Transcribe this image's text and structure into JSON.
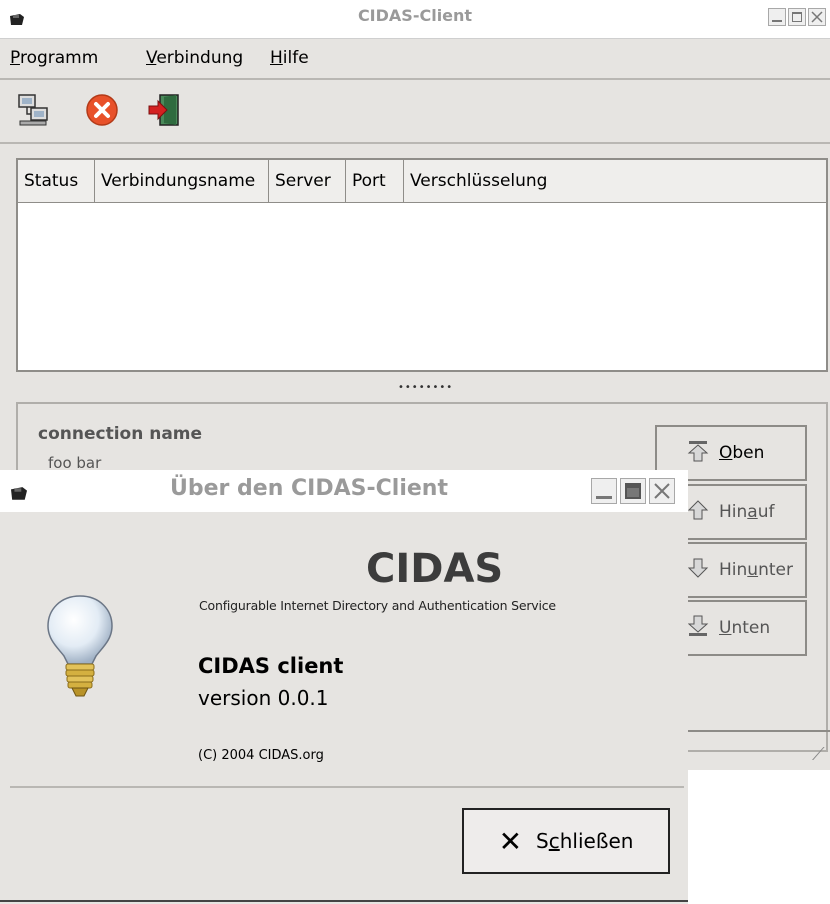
{
  "main_window": {
    "title": "CIDAS-Client",
    "menu": [
      {
        "label": "Programm",
        "mnemonic": "P",
        "rest": "rogramm"
      },
      {
        "label": "Verbindung",
        "mnemonic": "V",
        "rest": "erbindung"
      },
      {
        "label": "Hilfe",
        "mnemonic": "H",
        "rest": "ilfe"
      }
    ],
    "toolbar": [
      {
        "icon": "network-connect-icon"
      },
      {
        "icon": "disconnect-icon"
      },
      {
        "icon": "exit-door-icon"
      }
    ],
    "table": {
      "columns": [
        "Status",
        "Verbindungsname",
        "Server",
        "Port",
        "Verschlüsselung"
      ],
      "rows": []
    },
    "splitter_grip": "••••••••",
    "details": {
      "heading": "connection name",
      "value": "foo bar"
    },
    "side_buttons": [
      {
        "label": "Oben",
        "mnemonic": "O",
        "rest": "ben",
        "icon": "top-arrow-icon"
      },
      {
        "label": "Hinauf",
        "pre": "Hin",
        "mnemonic": "a",
        "rest": "uf",
        "icon": "up-arrow-icon"
      },
      {
        "label": "Hinunter",
        "pre": "Hin",
        "mnemonic": "u",
        "rest": "nter",
        "icon": "down-arrow-icon"
      },
      {
        "label": "Unten",
        "mnemonic": "U",
        "rest": "nten",
        "icon": "bottom-arrow-icon"
      }
    ]
  },
  "about_dialog": {
    "title": "Über den CIDAS-Client",
    "product": "CIDAS",
    "product_full": "Configurable Internet Directory and Authentication Service",
    "client_name": "CIDAS client",
    "version": "version 0.0.1",
    "copyright": "(C) 2004 CIDAS.org",
    "close_button": {
      "pre": "S",
      "mnemonic": "c",
      "rest": "hließen",
      "label": "Schließen"
    }
  },
  "colors": {
    "window_bg": "#e6e4e1",
    "title_text": "#9a9a9a",
    "disconnect_red": "#e8512a"
  }
}
